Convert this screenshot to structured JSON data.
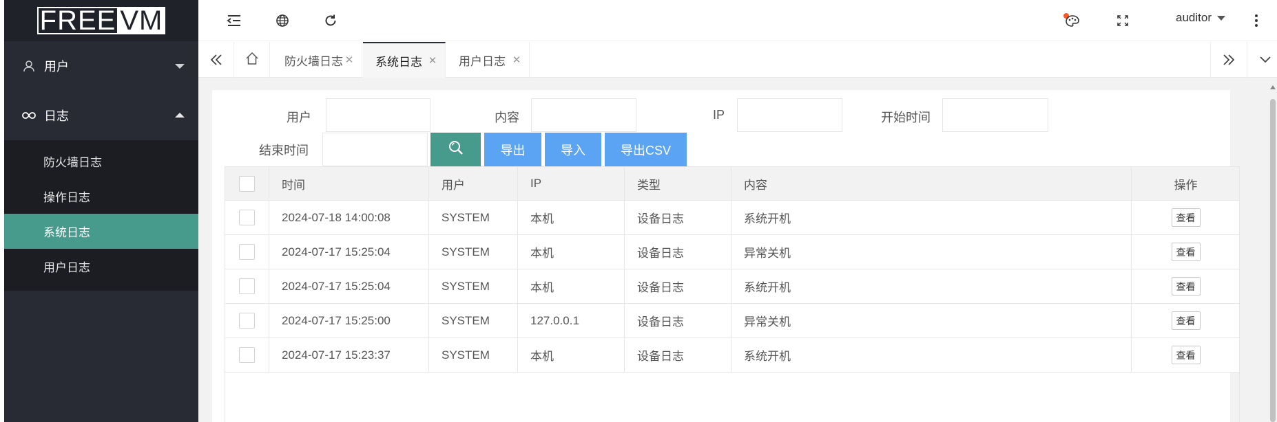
{
  "logo": {
    "part1": "FREE",
    "part2": "VM"
  },
  "sidebar": {
    "groups": [
      {
        "label": "用户",
        "expanded": false
      },
      {
        "label": "日志",
        "expanded": true
      }
    ],
    "log_items": [
      "防火墙日志",
      "操作日志",
      "系统日志",
      "用户日志"
    ],
    "active_item": "系统日志"
  },
  "header": {
    "icons": [
      "menu-fold-icon",
      "globe-icon",
      "refresh-icon",
      "theme-palette-icon",
      "fullscreen-icon",
      "more-vertical-icon"
    ],
    "notification_dot_color": "#ff5722",
    "username": "auditor"
  },
  "tabs": [
    {
      "label": "防火墙日志",
      "active": false
    },
    {
      "label": "系统日志",
      "active": true
    },
    {
      "label": "用户日志",
      "active": false
    }
  ],
  "filters": {
    "user_label": "用户",
    "content_label": "内容",
    "ip_label": "IP",
    "start_label": "开始时间",
    "end_label": "结束时间",
    "user_value": "",
    "content_value": "",
    "ip_value": "",
    "start_value": "",
    "end_value": ""
  },
  "buttons": {
    "export": "导出",
    "import": "导入",
    "export_csv": "导出CSV"
  },
  "table": {
    "columns": [
      "时间",
      "用户",
      "IP",
      "类型",
      "内容",
      "操作"
    ],
    "rows": [
      {
        "time": "2024-07-18 14:00:08",
        "user": "SYSTEM",
        "ip": "本机",
        "type": "设备日志",
        "content": "系统开机",
        "action": "查看"
      },
      {
        "time": "2024-07-17 15:25:04",
        "user": "SYSTEM",
        "ip": "本机",
        "type": "设备日志",
        "content": "异常关机",
        "action": "查看"
      },
      {
        "time": "2024-07-17 15:25:04",
        "user": "SYSTEM",
        "ip": "本机",
        "type": "设备日志",
        "content": "系统开机",
        "action": "查看"
      },
      {
        "time": "2024-07-17 15:25:00",
        "user": "SYSTEM",
        "ip": "127.0.0.1",
        "type": "设备日志",
        "content": "异常关机",
        "action": "查看"
      },
      {
        "time": "2024-07-17 15:23:37",
        "user": "SYSTEM",
        "ip": "本机",
        "type": "设备日志",
        "content": "系统开机",
        "action": "查看"
      }
    ]
  },
  "colors": {
    "sidebar_bg": "#282b33",
    "accent_green": "#479b8c",
    "button_blue": "#5aa4f3"
  }
}
